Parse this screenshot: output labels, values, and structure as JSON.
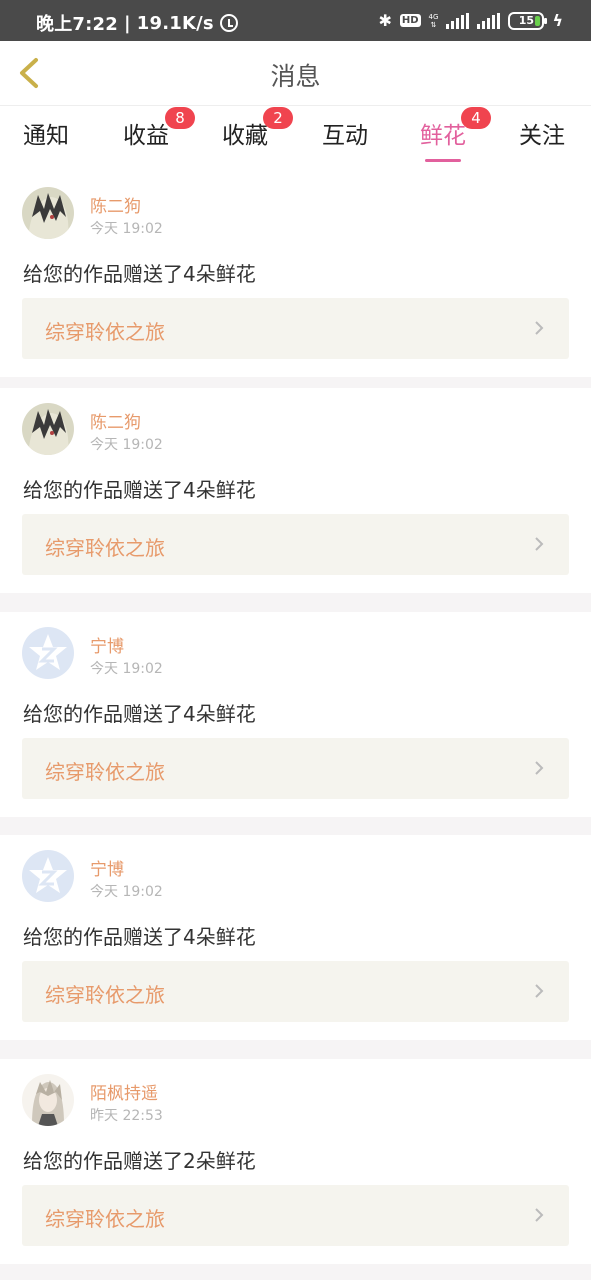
{
  "status_bar": {
    "time": "晚上7:22",
    "network_speed": "19.1K/s",
    "battery": "15",
    "icons": [
      "alarm-icon",
      "bluetooth-icon",
      "hd-icon",
      "4g-icon",
      "signal-icon",
      "battery-icon",
      "charging-icon"
    ]
  },
  "header": {
    "title": "消息",
    "back_icon": "back-chevron-icon"
  },
  "tabs": [
    {
      "label": "通知",
      "badge": null
    },
    {
      "label": "收益",
      "badge": "8"
    },
    {
      "label": "收藏",
      "badge": "2"
    },
    {
      "label": "互动",
      "badge": null
    },
    {
      "label": "鲜花",
      "badge": "4",
      "active": true
    },
    {
      "label": "关注",
      "badge": null
    }
  ],
  "colors": {
    "accent": "#e2609d",
    "badge": "#f0444f",
    "name": "#e79a6b",
    "link_bg": "#f5f4ee"
  },
  "messages": [
    {
      "user": "陈二狗",
      "time": "今天 19:02",
      "text": "给您的作品赠送了4朵鲜花",
      "work": "综穿聆依之旅",
      "avatar": "anime-avatar"
    },
    {
      "user": "陈二狗",
      "time": "今天 19:02",
      "text": "给您的作品赠送了4朵鲜花",
      "work": "综穿聆依之旅",
      "avatar": "anime-avatar"
    },
    {
      "user": "宁博",
      "time": "今天 19:02",
      "text": "给您的作品赠送了4朵鲜花",
      "work": "综穿聆依之旅",
      "avatar": "qq-default-avatar"
    },
    {
      "user": "宁博",
      "time": "今天 19:02",
      "text": "给您的作品赠送了4朵鲜花",
      "work": "综穿聆依之旅",
      "avatar": "qq-default-avatar"
    },
    {
      "user": "陌枫持遥",
      "time": "昨天 22:53",
      "text": "给您的作品赠送了2朵鲜花",
      "work": "综穿聆依之旅",
      "avatar": "anime-avatar-white-hair"
    }
  ]
}
